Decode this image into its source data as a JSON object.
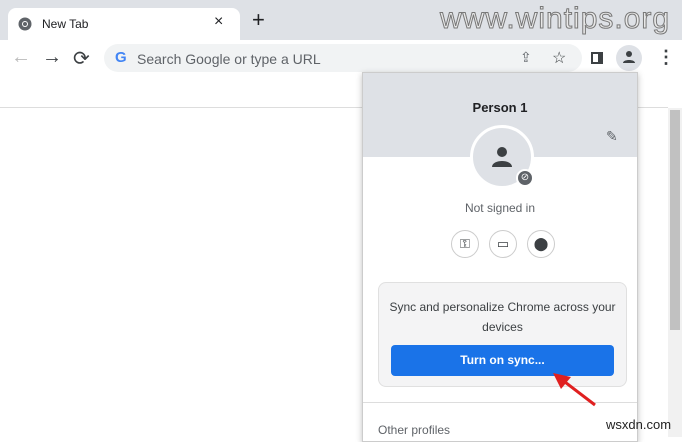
{
  "tab": {
    "title": "New Tab",
    "close": "×",
    "new_tab": "+"
  },
  "watermarks": [
    "www.wintips.org",
    "wsxdn.com"
  ],
  "toolbar": {
    "back": "←",
    "forward": "→",
    "reload": "⟳",
    "omnibox_placeholder": "Search Google or type a URL",
    "g_logo": "G"
  },
  "profile_menu": {
    "name": "Person 1",
    "status": "Not signed in",
    "sync_text": "Sync and personalize Chrome across your devices",
    "sync_button": "Turn on sync...",
    "other_profiles": "Other profiles"
  },
  "colors": {
    "accent": "#1a73e8",
    "arrow": "#e02020"
  }
}
